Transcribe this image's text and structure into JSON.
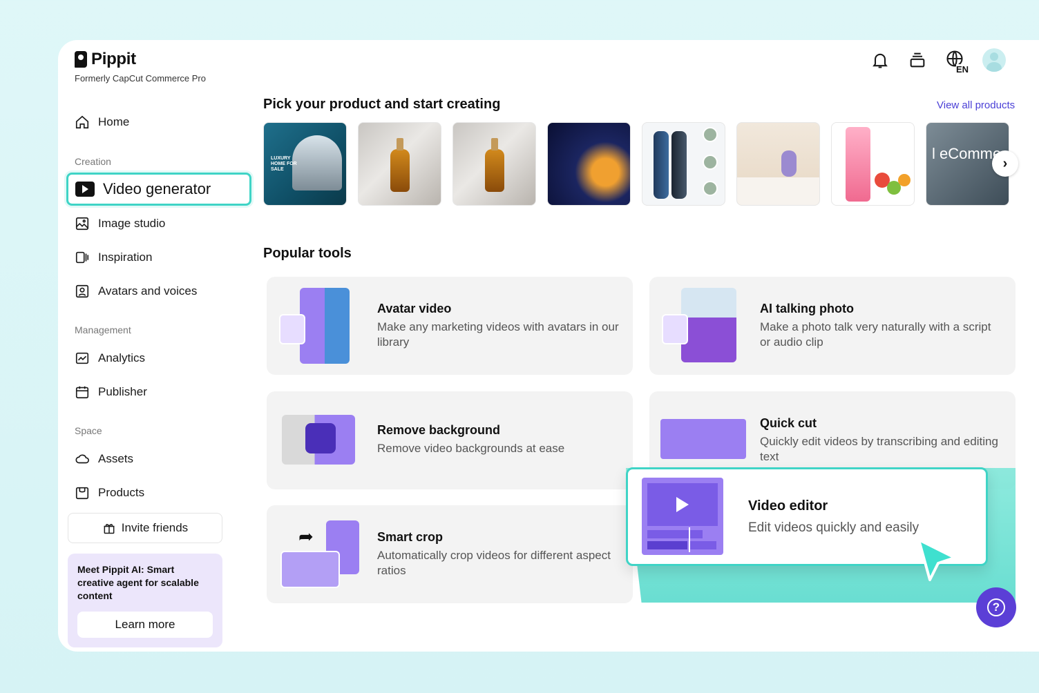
{
  "brand": {
    "name": "Pippit",
    "subtitle": "Formerly CapCut Commerce Pro"
  },
  "sidebar": {
    "home": "Home",
    "sections": {
      "creation": "Creation",
      "management": "Management",
      "space": "Space"
    },
    "creation_items": [
      "Video generator",
      "Image studio",
      "Inspiration",
      "Avatars and voices"
    ],
    "management_items": [
      "Analytics",
      "Publisher"
    ],
    "space_items": [
      "Assets",
      "Products"
    ],
    "invite": "Invite friends",
    "promo": {
      "text": "Meet Pippit AI: Smart creative agent for scalable content",
      "button": "Learn more"
    }
  },
  "topbar": {
    "language": "EN",
    "icons": [
      "bell-icon",
      "layers-icon",
      "globe-icon",
      "avatar"
    ]
  },
  "main": {
    "products_heading": "Pick your product and start creating",
    "view_all": "View all products",
    "thumb_labels": {
      "t1": "LUXURY HOME FOR SALE",
      "t8": "l eComme"
    },
    "tools_heading": "Popular tools",
    "tools": [
      {
        "title": "Avatar video",
        "desc": "Make any marketing videos with avatars in our library"
      },
      {
        "title": "AI talking photo",
        "desc": "Make a photo talk very naturally with a script or audio clip"
      },
      {
        "title": "Remove background",
        "desc": "Remove video backgrounds at ease"
      },
      {
        "title": "Quick cut",
        "desc": "Quickly edit videos by transcribing and editing text"
      },
      {
        "title": "Smart crop",
        "desc": "Automatically crop videos for different aspect ratios"
      }
    ],
    "highlight": {
      "title": "Video editor",
      "desc": "Edit videos quickly and easily"
    }
  },
  "colors": {
    "accent": "#3fd4c6",
    "brand_purple": "#5b3fd6",
    "link": "#4a3fd6"
  }
}
